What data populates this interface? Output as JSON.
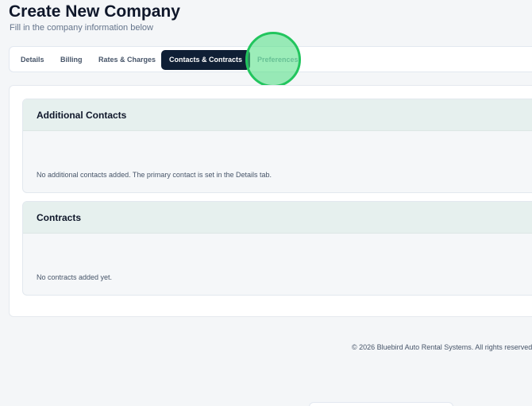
{
  "header": {
    "title": "Create New Company",
    "subtitle": "Fill in the company information below"
  },
  "tabs": [
    {
      "label": "Details",
      "active": false
    },
    {
      "label": "Billing",
      "active": false
    },
    {
      "label": "Rates & Charges",
      "active": false
    },
    {
      "label": "Contacts & Contracts",
      "active": true
    },
    {
      "label": "Preferences",
      "active": false
    }
  ],
  "sections": {
    "additional_contacts": {
      "title": "Additional Contacts",
      "empty_text": "No additional contacts added. The primary contact is set in the Details tab."
    },
    "contracts": {
      "title": "Contracts",
      "empty_text": "No contracts added yet."
    }
  },
  "footer": {
    "copyright": "© 2026 Bluebird Auto Rental Systems. All rights reserved."
  },
  "colors": {
    "active_tab_bg": "#0f1f35",
    "section_header_bg": "#e6f0ee",
    "highlight": "#22c55e"
  }
}
